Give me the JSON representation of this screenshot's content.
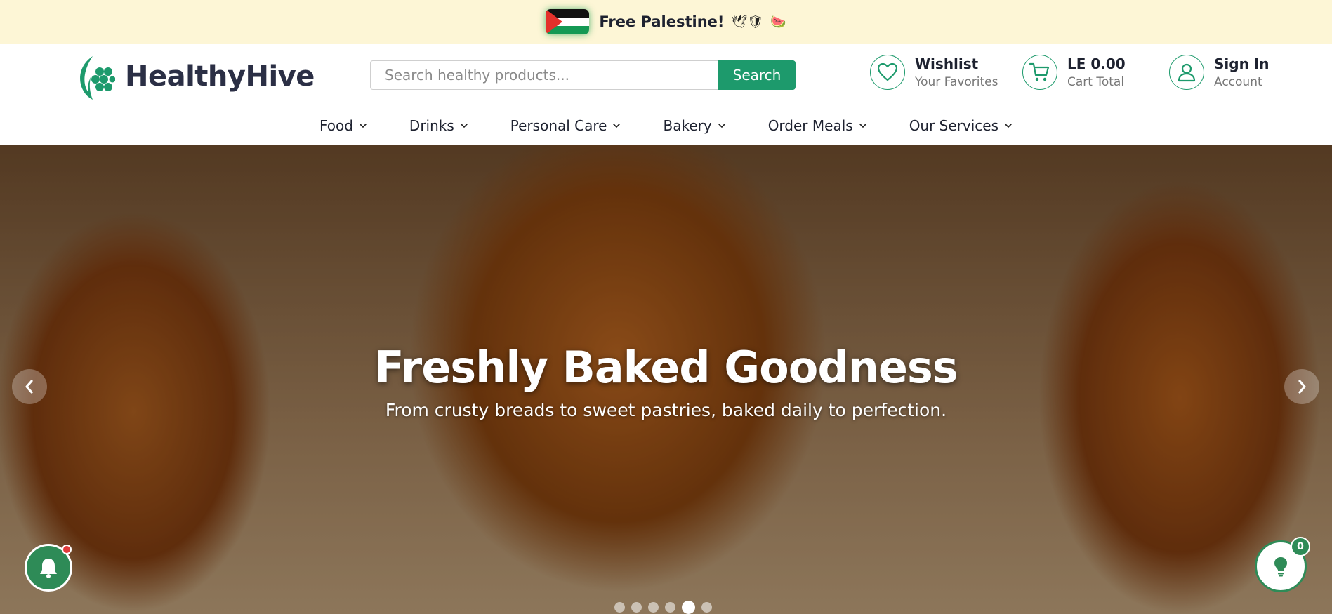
{
  "announcement": {
    "text": "Free Palestine!",
    "emojis": "🕊🛡",
    "watermelon_emoji": "🍉",
    "flag_icon": "palestine-flag-icon"
  },
  "brand": {
    "name": "HealthyHive",
    "color": "#1d9a6c"
  },
  "search": {
    "placeholder": "Search healthy products...",
    "value": "",
    "button_label": "Search"
  },
  "wishlist": {
    "title": "Wishlist",
    "subtitle": "Your Favorites",
    "icon": "heart-icon"
  },
  "cart": {
    "title": "LE 0.00",
    "subtitle": "Cart Total",
    "icon": "cart-icon"
  },
  "account": {
    "title": "Sign In",
    "subtitle": "Account",
    "icon": "user-icon"
  },
  "nav": {
    "items": [
      {
        "label": "Food"
      },
      {
        "label": "Drinks"
      },
      {
        "label": "Personal Care"
      },
      {
        "label": "Bakery"
      },
      {
        "label": "Order Meals"
      },
      {
        "label": "Our Services"
      }
    ]
  },
  "hero": {
    "title": "Freshly Baked Goodness",
    "subtitle": "From crusty breads to sweet pastries, baked daily to perfection.",
    "slide_count": 6,
    "active_slide": 5
  },
  "floating": {
    "notifications_icon": "bell-icon",
    "notifications_has_unread": true,
    "tips_icon": "lightbulb-icon",
    "tips_count": "0"
  }
}
